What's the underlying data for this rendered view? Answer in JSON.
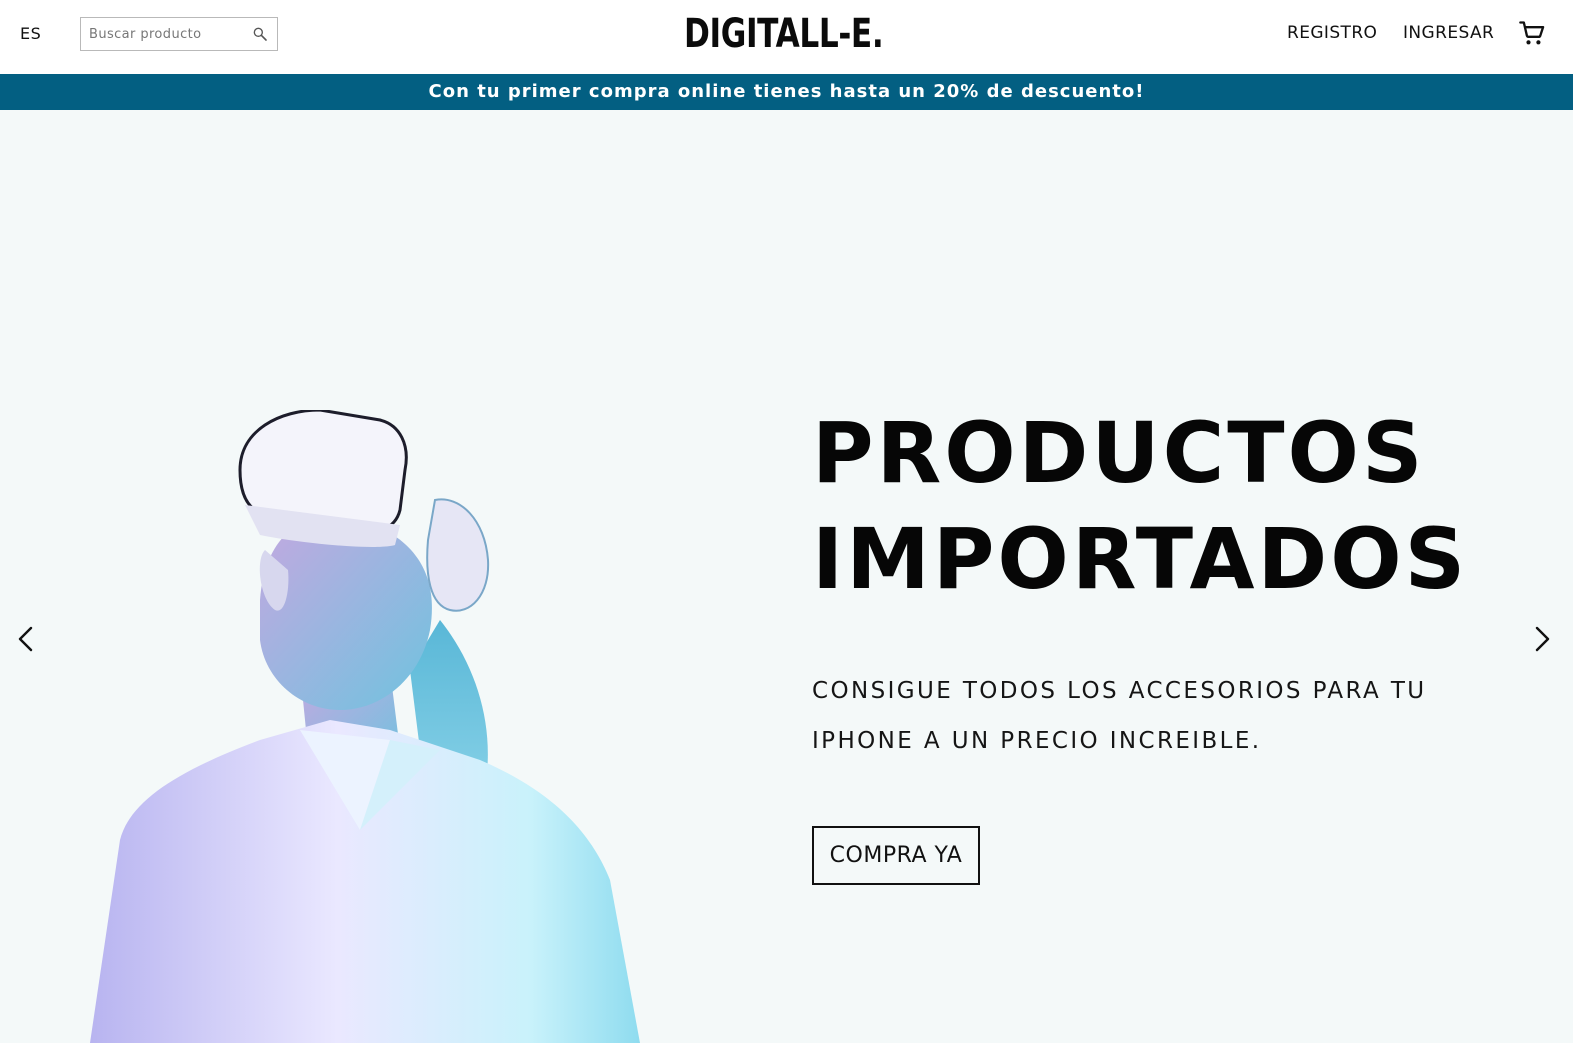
{
  "header": {
    "language": "ES",
    "search": {
      "placeholder": "Buscar producto",
      "value": ""
    },
    "logo": "DIGITALL-E.",
    "nav": {
      "register": "REGISTRO",
      "login": "INGRESAR"
    }
  },
  "promo_banner": "Con tu primer compra online tienes hasta un 20% de descuento!",
  "hero": {
    "headline_line1": "PRODUCTOS",
    "headline_line2": "IMPORTADOS",
    "subline_line1": "CONSIGUE TODOS LOS ACCESORIOS PARA TU",
    "subline_line2": "IPHONE A UN PRECIO INCREIBLE.",
    "cta": "COMPRA YA"
  },
  "icons": {
    "search": "search-icon",
    "cart": "shopping-cart-icon",
    "prev": "chevron-left-icon",
    "next": "chevron-right-icon"
  },
  "colors": {
    "promo_bg": "#035f82",
    "hero_bg": "#f4f9f9",
    "text": "#111111"
  }
}
